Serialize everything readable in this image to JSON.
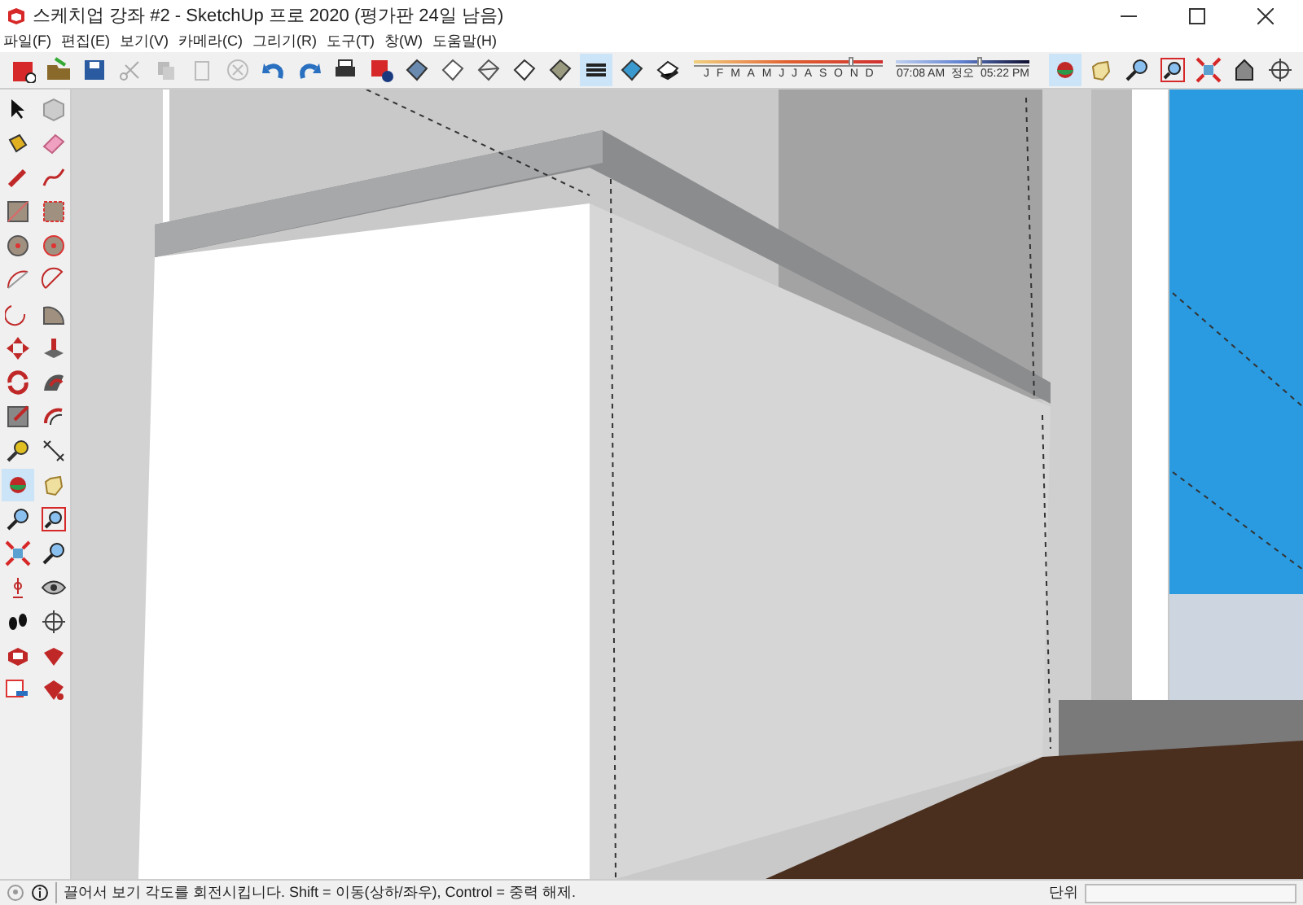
{
  "window": {
    "title": "스케치업 강좌 #2 - SketchUp 프로 2020 (평가판 24일 남음)"
  },
  "menu": [
    "파일(F)",
    "편집(E)",
    "보기(V)",
    "카메라(C)",
    "그리기(R)",
    "도구(T)",
    "창(W)",
    "도움말(H)"
  ],
  "toolbar": {
    "tools": [
      {
        "selected": false
      },
      {
        "selected": false
      },
      {
        "selected": false
      },
      {
        "selected": false
      },
      {
        "selected": false
      },
      {
        "selected": false
      },
      {
        "selected": false
      },
      {
        "selected": false
      },
      {
        "selected": false
      },
      {
        "selected": false
      },
      {
        "selected": false
      },
      {
        "selected": false
      },
      {
        "selected": false
      },
      {
        "selected": false
      },
      {
        "selected": false
      },
      {
        "selected": false
      },
      {
        "selected": true
      },
      {
        "selected": false
      },
      {
        "selected": false
      }
    ],
    "months": [
      "J",
      "F",
      "M",
      "A",
      "M",
      "J",
      "J",
      "A",
      "S",
      "O",
      "N",
      "D"
    ],
    "date_slider": {
      "level": 0.82
    },
    "time_start": "07:08 AM",
    "time_noon": "정오",
    "time_end": "05:22 PM",
    "time_slider": {
      "level": 0.62
    },
    "camera_tools": [
      {
        "selected": true
      },
      {
        "selected": false
      },
      {
        "selected": false
      },
      {
        "selected": false
      },
      {
        "selected": false
      },
      {
        "selected": false
      },
      {
        "selected": false
      }
    ]
  },
  "left_toolbar": [
    {
      "selected": false
    },
    {
      "selected": false
    },
    {
      "selected": false
    },
    {
      "selected": false
    },
    {
      "selected": false
    },
    {
      "selected": false
    },
    {
      "selected": false
    },
    {
      "selected": false
    },
    {
      "selected": false
    },
    {
      "selected": false
    },
    {
      "selected": false
    },
    {
      "selected": false
    },
    {
      "selected": false
    },
    {
      "selected": false
    },
    {
      "selected": false
    },
    {
      "selected": false
    },
    {
      "selected": false
    },
    {
      "selected": false
    },
    {
      "selected": false
    },
    {
      "selected": false
    },
    {
      "selected": false
    },
    {
      "selected": false
    },
    {
      "selected": true
    },
    {
      "selected": false
    },
    {
      "selected": false
    },
    {
      "selected": false
    },
    {
      "selected": false
    },
    {
      "selected": false
    },
    {
      "selected": false
    },
    {
      "selected": false
    },
    {
      "selected": false
    },
    {
      "selected": false
    },
    {
      "selected": false
    },
    {
      "selected": false
    },
    {
      "selected": false
    },
    {
      "selected": false
    }
  ],
  "status_bar": {
    "message": "끌어서 보기 각도를 회전시킵니다. Shift = 이동(상하/좌우), Control = 중력 해제.",
    "measurement_label": "단위"
  }
}
